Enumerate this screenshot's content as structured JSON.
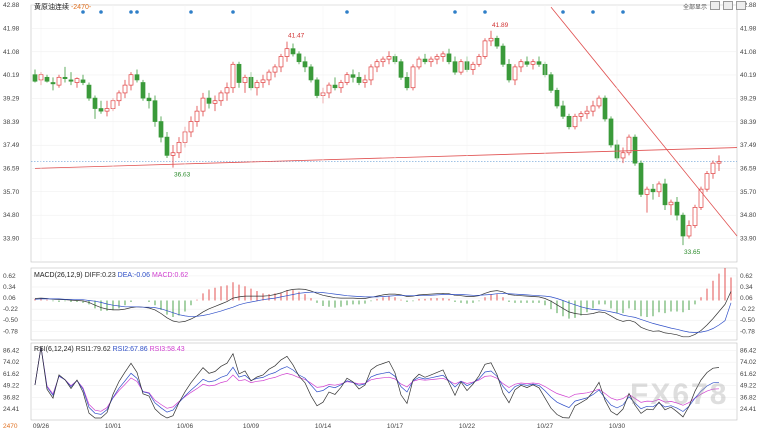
{
  "header": {
    "title": "黄原油连续",
    "sub": "-2470-"
  },
  "toolbar": {
    "label": "全部显示"
  },
  "watermark": "FX678",
  "chart_data": {
    "type": "candlestick",
    "price": {
      "yticks": [
        42.88,
        41.98,
        41.08,
        40.19,
        39.29,
        38.39,
        37.49,
        36.59,
        35.7,
        34.8,
        33.9
      ],
      "ylim": [
        33.0,
        42.88
      ],
      "annotations": [
        {
          "label": "41.47",
          "value": 41.47
        },
        {
          "label": "41.89",
          "value": 41.89
        },
        {
          "label": "36.63",
          "value": 36.63
        },
        {
          "label": "33.65",
          "value": 33.65
        }
      ],
      "last_price": 36.86,
      "trendlines": [
        {
          "from": [
            0,
            36.6
          ],
          "to": [
            117,
            37.4
          ],
          "color": "#e05050"
        },
        {
          "from": [
            86,
            42.8
          ],
          "to": [
            117,
            34.0
          ],
          "color": "#e05050"
        }
      ],
      "candles": [
        [
          40.2,
          40.4,
          39.9,
          39.95
        ],
        [
          40.0,
          40.3,
          39.8,
          40.2
        ],
        [
          40.1,
          40.2,
          39.9,
          39.95
        ],
        [
          39.9,
          40.1,
          39.6,
          39.85
        ],
        [
          39.8,
          40.2,
          39.7,
          40.1
        ],
        [
          40.1,
          40.5,
          39.9,
          40.05
        ],
        [
          40.0,
          40.3,
          39.8,
          39.95
        ],
        [
          39.9,
          40.1,
          39.7,
          40.05
        ],
        [
          40.0,
          40.2,
          39.8,
          39.9
        ],
        [
          39.8,
          39.9,
          39.2,
          39.3
        ],
        [
          39.3,
          39.4,
          38.5,
          38.9
        ],
        [
          38.9,
          39.2,
          38.7,
          38.8
        ],
        [
          38.8,
          39.2,
          38.6,
          38.9
        ],
        [
          38.9,
          39.3,
          38.8,
          39.2
        ],
        [
          39.2,
          39.6,
          39.0,
          39.5
        ],
        [
          39.5,
          40.0,
          39.3,
          39.8
        ],
        [
          39.8,
          40.3,
          39.6,
          40.2
        ],
        [
          40.2,
          40.4,
          39.9,
          40.0
        ],
        [
          39.9,
          40.0,
          39.2,
          39.3
        ],
        [
          39.3,
          39.5,
          38.9,
          39.2
        ],
        [
          39.2,
          39.4,
          38.2,
          38.4
        ],
        [
          38.4,
          38.6,
          37.6,
          37.8
        ],
        [
          37.8,
          38.0,
          37.0,
          37.1
        ],
        [
          37.1,
          37.5,
          36.63,
          37.2
        ],
        [
          37.2,
          37.8,
          37.0,
          37.6
        ],
        [
          37.6,
          38.2,
          37.4,
          38.0
        ],
        [
          38.0,
          38.6,
          37.8,
          38.4
        ],
        [
          38.4,
          39.0,
          38.2,
          38.8
        ],
        [
          38.8,
          39.5,
          38.6,
          39.3
        ],
        [
          39.3,
          39.6,
          38.9,
          39.1
        ],
        [
          39.1,
          39.4,
          38.8,
          39.2
        ],
        [
          39.2,
          39.6,
          39.0,
          39.5
        ],
        [
          39.5,
          39.9,
          39.2,
          39.7
        ],
        [
          39.7,
          40.7,
          39.5,
          40.6
        ],
        [
          40.6,
          40.7,
          39.7,
          39.9
        ],
        [
          39.9,
          40.2,
          39.5,
          40.1
        ],
        [
          40.1,
          40.3,
          39.6,
          39.7
        ],
        [
          39.7,
          40.0,
          39.4,
          39.9
        ],
        [
          39.9,
          40.2,
          39.7,
          40.0
        ],
        [
          40.0,
          40.4,
          39.8,
          40.3
        ],
        [
          40.3,
          40.6,
          40.1,
          40.5
        ],
        [
          40.5,
          41.0,
          40.3,
          40.9
        ],
        [
          40.9,
          41.47,
          40.7,
          41.2
        ],
        [
          41.2,
          41.4,
          40.9,
          41.0
        ],
        [
          41.0,
          41.1,
          40.6,
          40.7
        ],
        [
          40.7,
          40.9,
          40.3,
          40.5
        ],
        [
          40.5,
          40.6,
          39.9,
          40.0
        ],
        [
          40.0,
          40.1,
          39.3,
          39.4
        ],
        [
          39.4,
          39.7,
          39.1,
          39.5
        ],
        [
          39.5,
          39.9,
          39.3,
          39.8
        ],
        [
          39.8,
          40.1,
          39.6,
          39.7
        ],
        [
          39.7,
          40.0,
          39.5,
          39.9
        ],
        [
          39.9,
          40.3,
          39.8,
          40.2
        ],
        [
          40.2,
          40.4,
          39.9,
          40.1
        ],
        [
          40.1,
          40.3,
          39.8,
          39.9
        ],
        [
          39.9,
          40.2,
          39.7,
          40.0
        ],
        [
          40.0,
          40.6,
          39.8,
          40.5
        ],
        [
          40.5,
          40.8,
          40.3,
          40.7
        ],
        [
          40.7,
          40.9,
          40.5,
          40.8
        ],
        [
          40.8,
          41.1,
          40.6,
          40.9
        ],
        [
          40.9,
          41.0,
          40.6,
          40.7
        ],
        [
          40.7,
          40.8,
          40.0,
          40.1
        ],
        [
          40.1,
          40.3,
          39.6,
          39.7
        ],
        [
          39.7,
          40.6,
          39.6,
          40.5
        ],
        [
          40.5,
          40.9,
          40.4,
          40.8
        ],
        [
          40.8,
          41.0,
          40.6,
          40.7
        ],
        [
          40.7,
          40.9,
          40.5,
          40.8
        ],
        [
          40.8,
          41.0,
          40.6,
          40.9
        ],
        [
          40.9,
          41.1,
          40.7,
          41.0
        ],
        [
          41.0,
          41.2,
          40.6,
          40.7
        ],
        [
          40.7,
          40.9,
          40.2,
          40.3
        ],
        [
          40.3,
          40.8,
          40.2,
          40.7
        ],
        [
          40.7,
          40.9,
          40.3,
          40.4
        ],
        [
          40.4,
          40.7,
          40.2,
          40.6
        ],
        [
          40.6,
          41.0,
          40.5,
          40.9
        ],
        [
          40.9,
          41.6,
          40.8,
          41.5
        ],
        [
          41.5,
          41.89,
          41.3,
          41.6
        ],
        [
          41.6,
          41.7,
          41.2,
          41.3
        ],
        [
          41.3,
          41.4,
          40.5,
          40.6
        ],
        [
          40.6,
          40.8,
          39.9,
          40.0
        ],
        [
          40.0,
          40.6,
          39.8,
          40.5
        ],
        [
          40.5,
          40.8,
          40.3,
          40.7
        ],
        [
          40.7,
          40.9,
          40.5,
          40.6
        ],
        [
          40.6,
          40.8,
          40.4,
          40.7
        ],
        [
          40.7,
          40.9,
          40.5,
          40.6
        ],
        [
          40.6,
          40.7,
          40.1,
          40.2
        ],
        [
          40.2,
          40.3,
          39.5,
          39.6
        ],
        [
          39.6,
          39.7,
          38.9,
          39.0
        ],
        [
          39.0,
          39.2,
          38.5,
          38.6
        ],
        [
          38.6,
          38.7,
          38.1,
          38.2
        ],
        [
          38.2,
          38.7,
          38.1,
          38.6
        ],
        [
          38.6,
          38.8,
          38.4,
          38.7
        ],
        [
          38.7,
          39.0,
          38.5,
          38.8
        ],
        [
          38.8,
          39.2,
          38.6,
          39.0
        ],
        [
          39.0,
          39.4,
          38.9,
          39.3
        ],
        [
          39.3,
          39.4,
          38.4,
          38.5
        ],
        [
          38.5,
          38.6,
          37.4,
          37.5
        ],
        [
          37.5,
          37.7,
          36.9,
          37.0
        ],
        [
          37.0,
          37.4,
          36.8,
          37.2
        ],
        [
          37.2,
          37.9,
          37.1,
          37.8
        ],
        [
          37.8,
          37.9,
          36.7,
          36.8
        ],
        [
          36.8,
          36.9,
          35.5,
          35.6
        ],
        [
          35.6,
          35.9,
          34.9,
          35.8
        ],
        [
          35.8,
          36.0,
          35.4,
          35.7
        ],
        [
          35.7,
          36.1,
          35.5,
          36.0
        ],
        [
          36.0,
          36.2,
          35.0,
          35.2
        ],
        [
          35.2,
          35.4,
          34.8,
          35.3
        ],
        [
          35.3,
          35.5,
          34.6,
          34.8
        ],
        [
          34.8,
          34.9,
          33.65,
          34.0
        ],
        [
          34.0,
          34.6,
          33.9,
          34.4
        ],
        [
          34.4,
          35.2,
          34.3,
          35.1
        ],
        [
          35.1,
          35.9,
          35.0,
          35.8
        ],
        [
          35.8,
          36.5,
          35.7,
          36.4
        ],
        [
          36.4,
          36.9,
          36.2,
          36.8
        ],
        [
          36.8,
          37.1,
          36.5,
          36.86
        ]
      ]
    },
    "macd": {
      "label": "MACD(26,12,9)",
      "values": {
        "DIFF": "0.23",
        "DEA": "-0.06",
        "MACD": "0.62"
      },
      "label_colors": {
        "DIFF": "#444444",
        "DEA": "#3050c8",
        "MACD": "#d040d0"
      },
      "yticks": [
        0.62,
        0.34,
        0.06,
        -0.22,
        -0.5,
        -0.78
      ],
      "ylim": [
        -0.95,
        0.72
      ],
      "diff": [
        0.05,
        0.06,
        0.05,
        0.03,
        0.02,
        0.02,
        0.01,
        0.0,
        -0.01,
        -0.05,
        -0.12,
        -0.18,
        -0.22,
        -0.24,
        -0.24,
        -0.22,
        -0.18,
        -0.16,
        -0.17,
        -0.19,
        -0.24,
        -0.33,
        -0.44,
        -0.52,
        -0.55,
        -0.53,
        -0.47,
        -0.39,
        -0.29,
        -0.21,
        -0.15,
        -0.09,
        -0.03,
        0.06,
        0.09,
        0.11,
        0.11,
        0.11,
        0.11,
        0.12,
        0.15,
        0.19,
        0.25,
        0.28,
        0.29,
        0.28,
        0.24,
        0.18,
        0.13,
        0.1,
        0.07,
        0.06,
        0.06,
        0.06,
        0.05,
        0.05,
        0.08,
        0.11,
        0.14,
        0.16,
        0.16,
        0.14,
        0.1,
        0.11,
        0.14,
        0.15,
        0.16,
        0.17,
        0.18,
        0.17,
        0.13,
        0.12,
        0.1,
        0.1,
        0.12,
        0.18,
        0.23,
        0.25,
        0.22,
        0.15,
        0.13,
        0.12,
        0.11,
        0.1,
        0.09,
        0.05,
        -0.02,
        -0.11,
        -0.2,
        -0.29,
        -0.33,
        -0.35,
        -0.35,
        -0.33,
        -0.29,
        -0.31,
        -0.39,
        -0.48,
        -0.53,
        -0.5,
        -0.55,
        -0.68,
        -0.74,
        -0.78,
        -0.77,
        -0.82,
        -0.84,
        -0.87,
        -0.92,
        -0.92,
        -0.86,
        -0.76,
        -0.62,
        -0.46,
        -0.28,
        -0.1,
        0.23
      ],
      "dea": [
        0.03,
        0.04,
        0.04,
        0.04,
        0.04,
        0.03,
        0.03,
        0.02,
        0.02,
        0.0,
        -0.02,
        -0.05,
        -0.09,
        -0.12,
        -0.14,
        -0.16,
        -0.16,
        -0.16,
        -0.17,
        -0.17,
        -0.18,
        -0.21,
        -0.26,
        -0.31,
        -0.36,
        -0.39,
        -0.41,
        -0.4,
        -0.38,
        -0.35,
        -0.31,
        -0.27,
        -0.22,
        -0.17,
        -0.11,
        -0.07,
        -0.04,
        -0.01,
        0.02,
        0.04,
        0.06,
        0.09,
        0.12,
        0.15,
        0.18,
        0.2,
        0.21,
        0.21,
        0.2,
        0.18,
        0.16,
        0.14,
        0.12,
        0.11,
        0.1,
        0.09,
        0.09,
        0.09,
        0.1,
        0.11,
        0.12,
        0.13,
        0.12,
        0.12,
        0.12,
        0.13,
        0.13,
        0.14,
        0.15,
        0.15,
        0.15,
        0.15,
        0.14,
        0.13,
        0.13,
        0.14,
        0.15,
        0.17,
        0.18,
        0.17,
        0.16,
        0.15,
        0.14,
        0.13,
        0.12,
        0.11,
        0.09,
        0.05,
        0.0,
        -0.06,
        -0.11,
        -0.16,
        -0.2,
        -0.23,
        -0.24,
        -0.26,
        -0.29,
        -0.32,
        -0.37,
        -0.4,
        -0.43,
        -0.48,
        -0.53,
        -0.58,
        -0.62,
        -0.66,
        -0.7,
        -0.73,
        -0.77,
        -0.8,
        -0.81,
        -0.8,
        -0.77,
        -0.71,
        -0.62,
        -0.51,
        -0.06
      ]
    },
    "rsi": {
      "label": "RSI(6,12,24)",
      "values": {
        "RSI1": "79.62",
        "RSI2": "67.86",
        "RSI3": "58.43"
      },
      "label_colors": {
        "RSI1": "#333333",
        "RSI2": "#3050c8",
        "RSI3": "#d040d0"
      },
      "yticks": [
        86.42,
        74.02,
        61.62,
        49.22,
        36.82,
        24.41
      ],
      "ylim": [
        15.0,
        90.0
      ]
    },
    "xaxis": {
      "labels": [
        {
          "label": "09/26",
          "index": 1
        },
        {
          "label": "10/01",
          "index": 13
        },
        {
          "label": "10/06",
          "index": 25
        },
        {
          "label": "10/09",
          "index": 36
        },
        {
          "label": "10/14",
          "index": 48
        },
        {
          "label": "10/17",
          "index": 60
        },
        {
          "label": "10/22",
          "index": 72
        },
        {
          "label": "10/27",
          "index": 85
        },
        {
          "label": "10/30",
          "index": 97
        }
      ],
      "corner_label": "2470"
    },
    "event_dots": [
      8,
      11,
      16,
      17,
      26,
      33,
      52,
      70,
      75,
      88,
      93,
      98
    ]
  }
}
